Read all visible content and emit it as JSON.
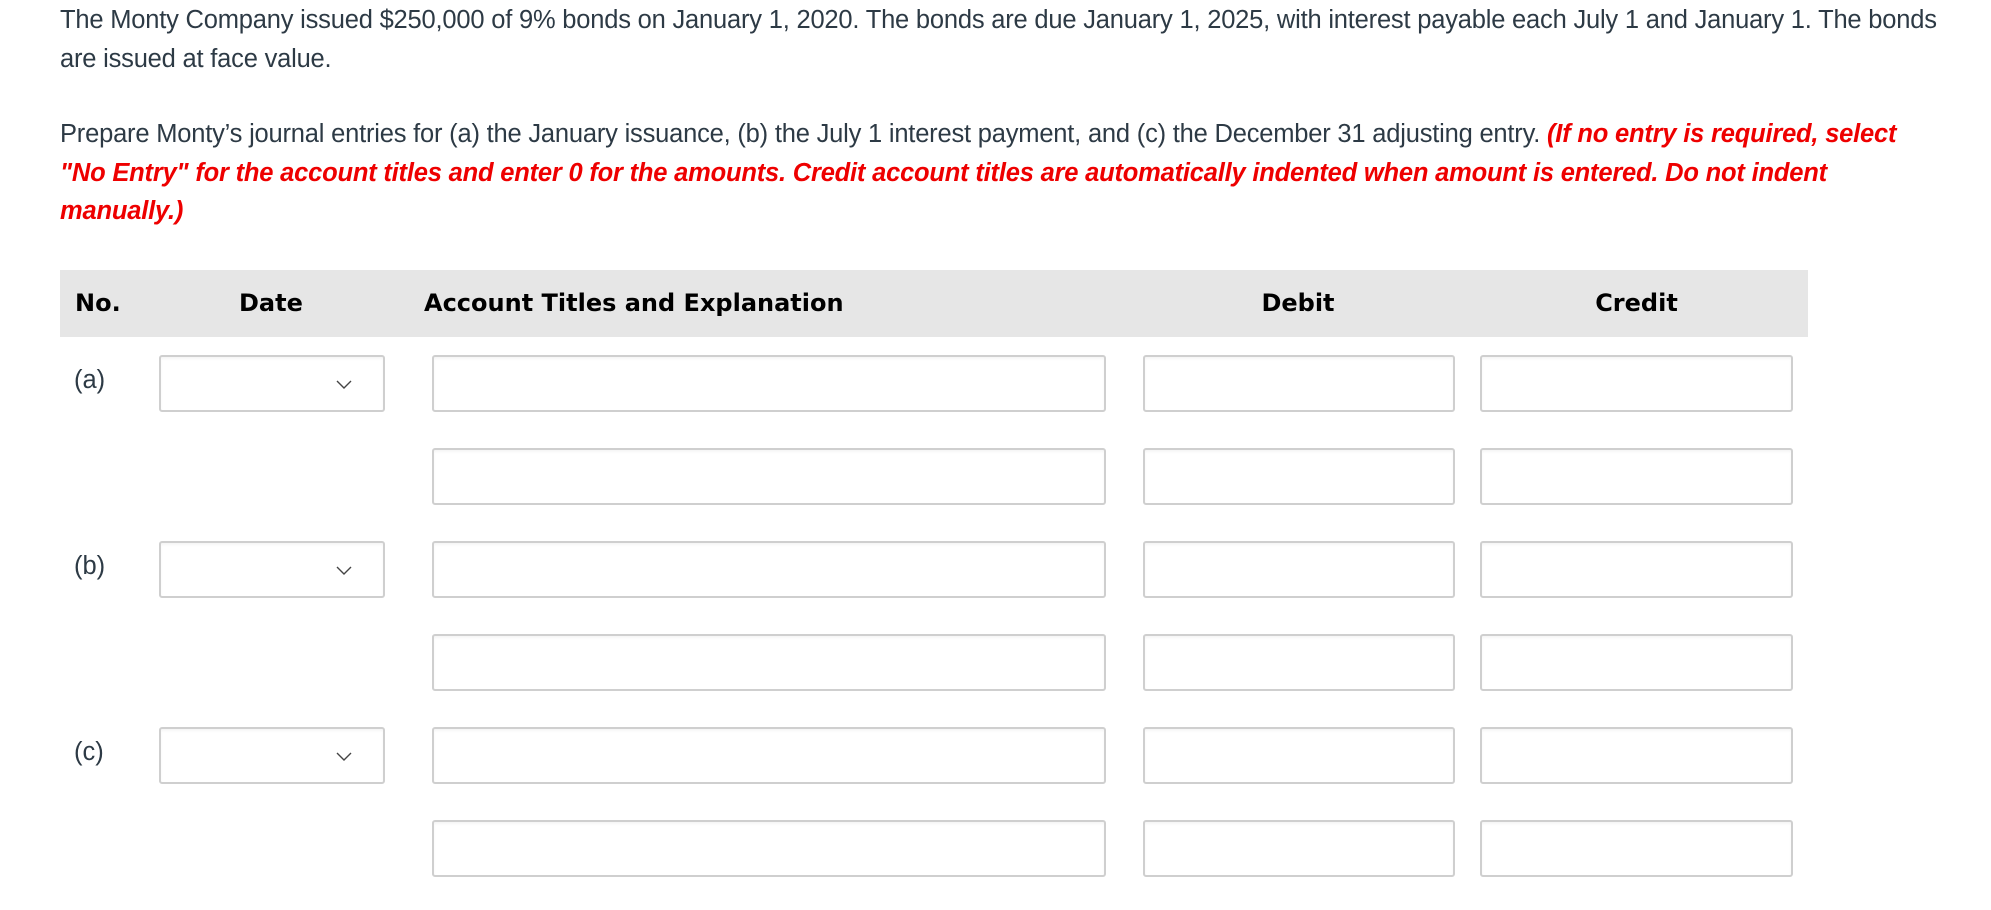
{
  "problem": {
    "statement": "The Monty Company issued $250,000 of 9% bonds on January 1, 2020. The bonds are due January 1, 2025, with interest payable each July 1 and January 1. The bonds are issued at face value.",
    "prompt": "Prepare Monty’s journal entries for (a) the January issuance, (b) the July 1 interest payment, and (c) the December 31 adjusting entry. ",
    "instructions": "(If no entry is required, select \"No Entry\" for the account titles and enter 0 for the amounts. Credit account titles are automatically indented when amount is entered. Do not indent manually.)"
  },
  "table": {
    "headers": {
      "no": "No.",
      "date": "Date",
      "account": "Account Titles and Explanation",
      "debit": "Debit",
      "credit": "Credit"
    },
    "entries": [
      {
        "label": "(a)",
        "date": "",
        "lines": [
          {
            "account": "",
            "debit": "",
            "credit": ""
          },
          {
            "account": "",
            "debit": "",
            "credit": ""
          }
        ]
      },
      {
        "label": "(b)",
        "date": "",
        "lines": [
          {
            "account": "",
            "debit": "",
            "credit": ""
          },
          {
            "account": "",
            "debit": "",
            "credit": ""
          }
        ]
      },
      {
        "label": "(c)",
        "date": "",
        "lines": [
          {
            "account": "",
            "debit": "",
            "credit": ""
          },
          {
            "account": "",
            "debit": "",
            "credit": ""
          }
        ]
      }
    ]
  },
  "icons": {
    "date_dropdown": "chevron-down-icon"
  },
  "colors": {
    "text": "#2d3a45",
    "instruction": "#ee0000",
    "header_bg": "#e6e6e6",
    "field_border": "#cfcfcf"
  }
}
